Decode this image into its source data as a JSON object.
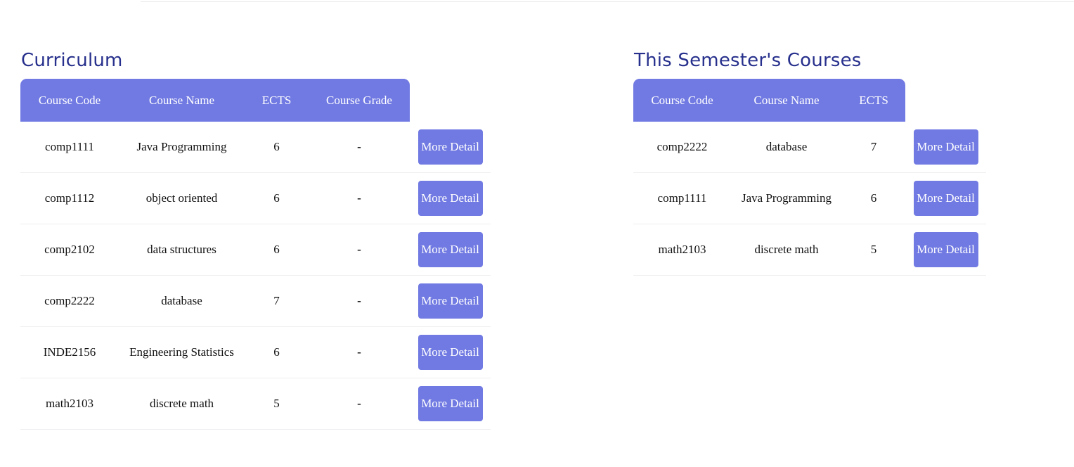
{
  "curriculum": {
    "title": "Curriculum",
    "headers": [
      "Course Code",
      "Course Name",
      "ECTS",
      "Course Grade"
    ],
    "rows": [
      {
        "code": "comp1111",
        "name": "Java Programming",
        "ects": "6",
        "grade": "-",
        "action": "More Detail"
      },
      {
        "code": "comp1112",
        "name": "object oriented",
        "ects": "6",
        "grade": "-",
        "action": "More Detail"
      },
      {
        "code": "comp2102",
        "name": "data structures",
        "ects": "6",
        "grade": "-",
        "action": "More Detail"
      },
      {
        "code": "comp2222",
        "name": "database",
        "ects": "7",
        "grade": "-",
        "action": "More Detail"
      },
      {
        "code": "INDE2156",
        "name": "Engineering Statistics",
        "ects": "6",
        "grade": "-",
        "action": "More Detail"
      },
      {
        "code": "math2103",
        "name": "discrete math",
        "ects": "5",
        "grade": "-",
        "action": "More Detail"
      }
    ]
  },
  "semester": {
    "title": "This Semester's Courses",
    "headers": [
      "Course Code",
      "Course Name",
      "ECTS"
    ],
    "rows": [
      {
        "code": "comp2222",
        "name": "database",
        "ects": "7",
        "action": "More Detail"
      },
      {
        "code": "comp1111",
        "name": "Java Programming",
        "ects": "6",
        "action": "More Detail"
      },
      {
        "code": "math2103",
        "name": "discrete math",
        "ects": "5",
        "action": "More Detail"
      }
    ]
  },
  "colors": {
    "accent": "#717ae2",
    "title": "#27308c",
    "row_divider": "#eeeef0"
  }
}
